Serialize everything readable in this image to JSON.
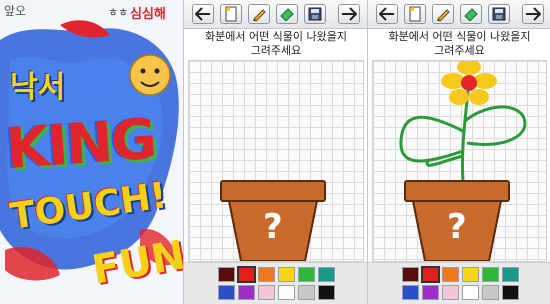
{
  "splash": {
    "logo_line1": "낙서",
    "logo_line2": "KING",
    "logo_line3": "TOUCH!",
    "fun_text": "FUN",
    "top_left_text": "앞오",
    "top_right_text": "심심해",
    "dots_text": "ㅎㅎ",
    "colors": {
      "blue_splash": "#2a5fd8",
      "red_splash": "#e0262c",
      "yellow_logo": "#f5d11c",
      "green_logo": "#39b54a"
    }
  },
  "screens": [
    {
      "toolbar": {
        "back_label": "back-arrow-icon",
        "new_label": "new-page-icon",
        "pencil_label": "pencil-icon",
        "eraser_label": "eraser-icon",
        "save_label": "save-icon",
        "next_label": "forward-arrow-icon"
      },
      "prompt_line1": "화분에서 어떤 식물이 나왔을지",
      "prompt_line2": "그려주세요",
      "pot_symbol": "?",
      "palette": [
        "#5a0d0d",
        "#e01f1f",
        "#f07a1a",
        "#f7d51d",
        "#2db83a",
        "#1a9a8a",
        "#2a4fc9",
        "#9b2fc8",
        "#f2c6d8",
        "#ffffff",
        "#c9c9c9",
        "#111111"
      ],
      "selected_swatch": 1
    },
    {
      "toolbar": {
        "back_label": "back-arrow-icon",
        "new_label": "new-page-icon",
        "pencil_label": "pencil-icon",
        "eraser_label": "eraser-icon",
        "save_label": "save-icon",
        "next_label": "forward-arrow-icon"
      },
      "prompt_line1": "화분에서 어떤 식물이 나왔을지",
      "prompt_line2": "그려주세요",
      "pot_symbol": "?",
      "palette": [
        "#5a0d0d",
        "#e01f1f",
        "#f07a1a",
        "#f7d51d",
        "#2db83a",
        "#1a9a8a",
        "#2a4fc9",
        "#9b2fc8",
        "#f2c6d8",
        "#ffffff",
        "#c9c9c9",
        "#111111"
      ],
      "selected_swatch": 1,
      "drawing": {
        "flower_petal_color": "#f7c91c",
        "flower_center_color": "#e3262a",
        "stem_color": "#2a9a3a"
      }
    }
  ]
}
